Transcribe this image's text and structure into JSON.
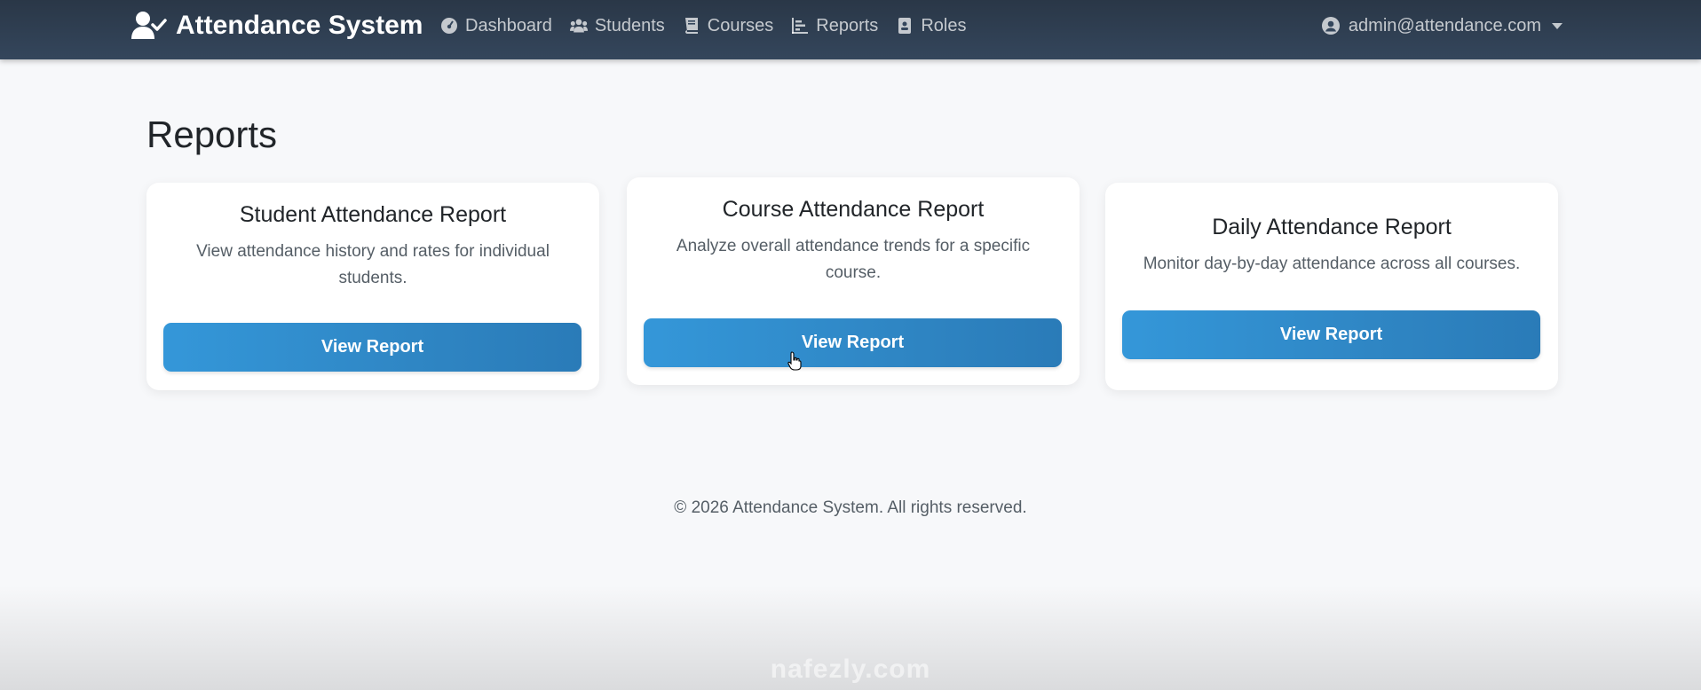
{
  "navbar": {
    "brand": "Attendance System",
    "brand_icon": "user-check-icon",
    "links": [
      {
        "label": "Dashboard",
        "icon": "dashboard-gauge-icon"
      },
      {
        "label": "Students",
        "icon": "users-icon"
      },
      {
        "label": "Courses",
        "icon": "book-icon"
      },
      {
        "label": "Reports",
        "icon": "chart-bar-icon"
      },
      {
        "label": "Roles",
        "icon": "id-badge-icon"
      }
    ],
    "user": {
      "email": "admin@attendance.com",
      "icon": "user-circle-icon"
    }
  },
  "page": {
    "title": "Reports"
  },
  "cards": [
    {
      "title": "Student Attendance Report",
      "description": "View attendance history and rates for individual students.",
      "button": "View Report"
    },
    {
      "title": "Course Attendance Report",
      "description": "Analyze overall attendance trends for a specific course.",
      "button": "View Report"
    },
    {
      "title": "Daily Attendance Report",
      "description": "Monitor day-by-day attendance across all courses.",
      "button": "View Report"
    }
  ],
  "footer": {
    "text": "© 2026 Attendance System. All rights reserved."
  },
  "watermark": {
    "text": "nafezly.com"
  },
  "colors": {
    "navbar": "#2f3e50",
    "primary": "#3190d0",
    "background": "#f7f8fa"
  }
}
